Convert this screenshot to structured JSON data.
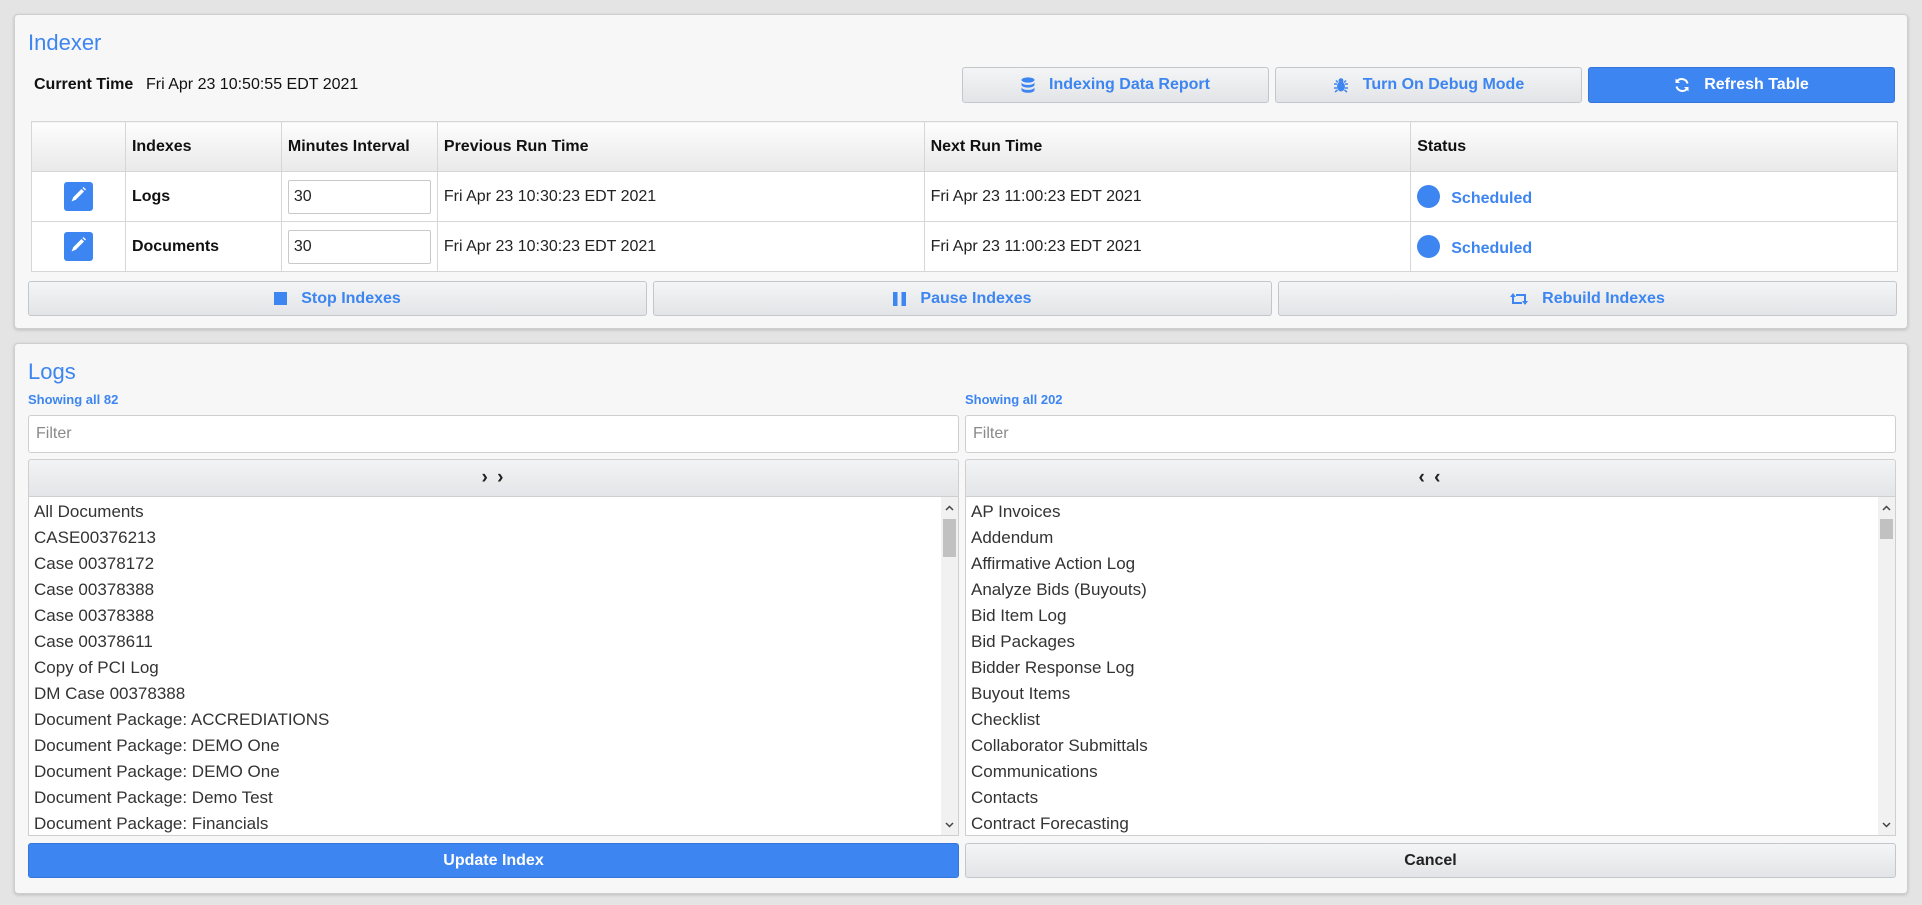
{
  "indexer": {
    "title": "Indexer",
    "current_time_label": "Current Time",
    "current_time_value": "Fri Apr 23 10:50:55 EDT 2021",
    "buttons": {
      "report": "Indexing Data Report",
      "debug": "Turn On Debug Mode",
      "refresh": "Refresh Table"
    },
    "table": {
      "headers": [
        "",
        "Indexes",
        "Minutes Interval",
        "Previous Run Time",
        "Next Run Time",
        "Status"
      ],
      "rows": [
        {
          "name": "Logs",
          "interval": "30",
          "previous": "Fri Apr 23 10:30:23 EDT 2021",
          "next": "Fri Apr 23 11:00:23 EDT 2021",
          "status": "Scheduled"
        },
        {
          "name": "Documents",
          "interval": "30",
          "previous": "Fri Apr 23 10:30:23 EDT 2021",
          "next": "Fri Apr 23 11:00:23 EDT 2021",
          "status": "Scheduled"
        }
      ]
    },
    "actions": {
      "stop": "Stop Indexes",
      "pause": "Pause Indexes",
      "rebuild": "Rebuild Indexes"
    }
  },
  "logs": {
    "title": "Logs",
    "left": {
      "showing": "Showing all 82",
      "filter_placeholder": "Filter",
      "move_label": "› ›",
      "items": [
        "All Documents",
        "CASE00376213",
        "Case 00378172",
        "Case 00378388",
        "Case 00378388",
        "Case 00378611",
        "Copy of PCI Log",
        "DM Case 00378388",
        "Document Package: ACCREDIATIONS",
        "Document Package: DEMO One",
        "Document Package: DEMO One",
        "Document Package: Demo Test",
        "Document Package: Financials"
      ]
    },
    "right": {
      "showing": "Showing all 202",
      "filter_placeholder": "Filter",
      "move_label": "‹ ‹",
      "items": [
        "AP Invoices",
        "Addendum",
        "Affirmative Action Log",
        "Analyze Bids (Buyouts)",
        "Bid Item Log",
        "Bid Packages",
        "Bidder Response Log",
        "Buyout Items",
        "Checklist",
        "Collaborator Submittals",
        "Communications",
        "Contacts",
        "Contract Forecasting"
      ]
    },
    "update_label": "Update Index",
    "cancel_label": "Cancel"
  },
  "colors": {
    "accent": "#3d85f0",
    "panel_bg": "#f7f7f7",
    "page_bg": "#e4e4e4"
  },
  "icons": {
    "report": "database-icon",
    "debug": "bug-icon",
    "refresh": "refresh-icon",
    "edit": "pencil-icon",
    "stop": "stop-icon",
    "pause": "pause-icon",
    "rebuild": "retweet-icon"
  }
}
